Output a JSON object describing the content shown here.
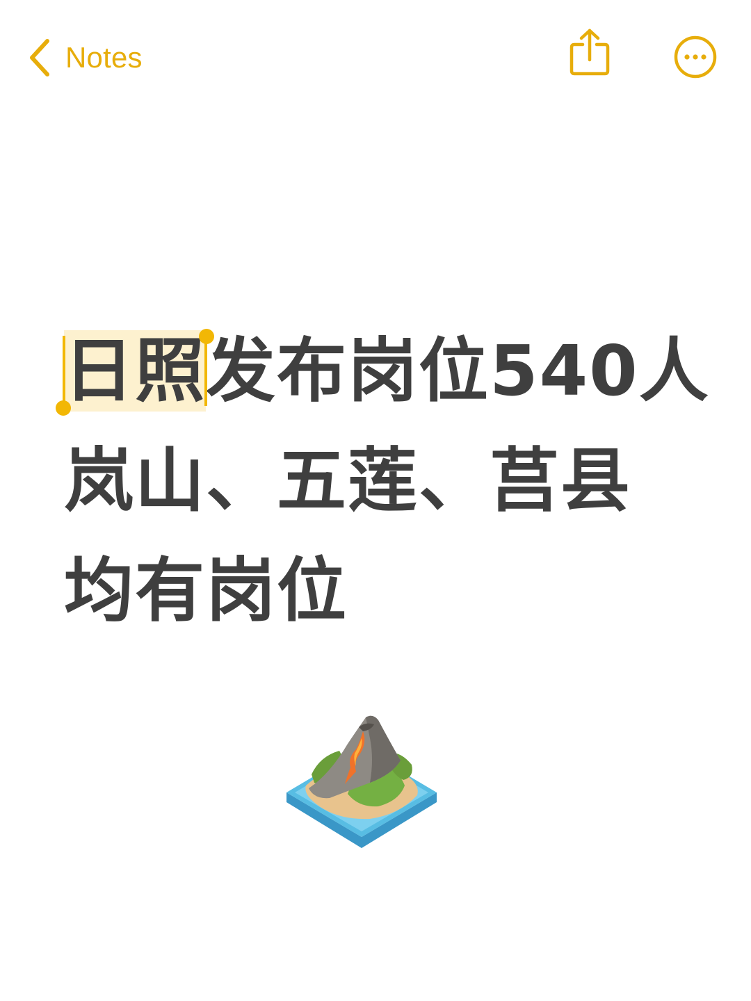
{
  "nav": {
    "back_label": "Notes",
    "back_icon": "chevron-left-icon",
    "share_icon": "share-icon",
    "more_icon": "ellipsis-circle-icon"
  },
  "note": {
    "line1_selected": "日照",
    "line1_rest": "发布岗位540人",
    "line2": "岚山、五莲、莒县",
    "line3": "均有岗位",
    "emoji": "island-volcano-icon"
  },
  "colors": {
    "accent": "#e7ad0b",
    "selection": "#fdf1cf",
    "text": "#3f3f3f",
    "background": "#ffffff"
  }
}
